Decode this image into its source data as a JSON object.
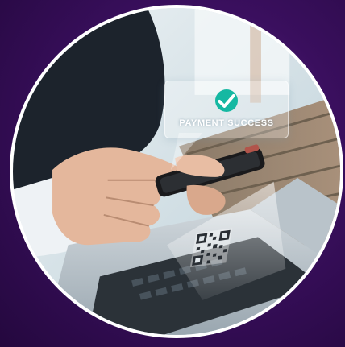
{
  "overlay": {
    "status_text": "PAYMENT SUCCESS",
    "status_icon": "check-circle-icon",
    "accent_color": "#15b8a2"
  },
  "background": {
    "outer_color": "#3a0f5e",
    "ring_color": "#ffffff"
  },
  "icons": {
    "qr": "qr-code-icon"
  }
}
